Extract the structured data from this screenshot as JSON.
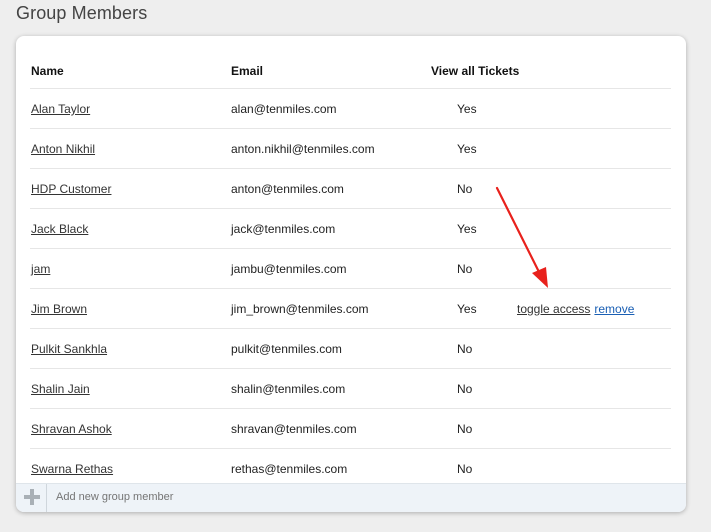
{
  "page": {
    "title": "Group Members"
  },
  "table": {
    "columns": {
      "name": "Name",
      "email": "Email",
      "tickets": "View all Tickets"
    },
    "rows": [
      {
        "name": "Alan Taylor",
        "email": "alan@tenmiles.com",
        "tickets": "Yes",
        "actions": false
      },
      {
        "name": "Anton Nikhil",
        "email": "anton.nikhil@tenmiles.com",
        "tickets": "Yes",
        "actions": false
      },
      {
        "name": "HDP Customer",
        "email": "anton@tenmiles.com",
        "tickets": "No",
        "actions": false
      },
      {
        "name": "Jack Black",
        "email": "jack@tenmiles.com",
        "tickets": "Yes",
        "actions": false
      },
      {
        "name": "jam",
        "email": "jambu@tenmiles.com",
        "tickets": "No",
        "actions": false
      },
      {
        "name": "Jim Brown",
        "email": "jim_brown@tenmiles.com",
        "tickets": "Yes",
        "actions": true
      },
      {
        "name": "Pulkit Sankhla",
        "email": "pulkit@tenmiles.com",
        "tickets": "No",
        "actions": false
      },
      {
        "name": "Shalin Jain",
        "email": "shalin@tenmiles.com",
        "tickets": "No",
        "actions": false
      },
      {
        "name": "Shravan Ashok",
        "email": "shravan@tenmiles.com",
        "tickets": "No",
        "actions": false
      },
      {
        "name": "Swarna Rethas",
        "email": "rethas@tenmiles.com",
        "tickets": "No",
        "actions": false
      }
    ],
    "row_actions": {
      "toggle_label": "toggle access",
      "remove_label": "remove"
    }
  },
  "footer": {
    "add_placeholder": "Add new group member",
    "add_icon": "plus-icon"
  },
  "annotation": {
    "arrow_color": "#e8211c"
  },
  "colors": {
    "link": "#1a5fb4",
    "footer_bg": "#eef3f8"
  }
}
